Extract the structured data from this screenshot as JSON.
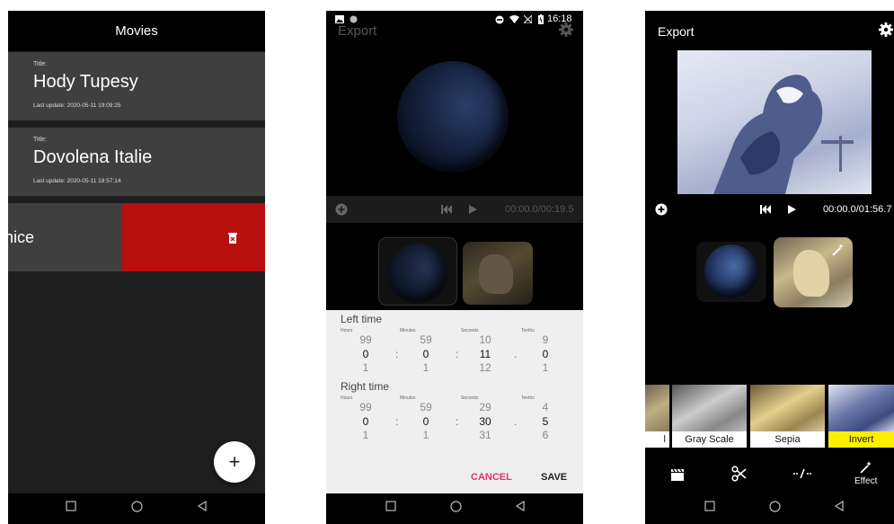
{
  "screen1": {
    "title": "Movies",
    "movies": [
      {
        "title_label": "Title:",
        "title": "Hody Tupesy",
        "updated": "Last update: 2020-05-11 19:09:25"
      },
      {
        "title_label": "Title:",
        "title": "Dovolena Italie",
        "updated": "Last update: 2020-05-11 18:57:14"
      }
    ],
    "swiped_item_text": "nice",
    "fab_label": "+"
  },
  "screen2": {
    "status_time": "16:18",
    "export_label": "Export",
    "time_display": "00:00.0/00:19.5",
    "left_time": {
      "label": "Left time",
      "captions": [
        "Hours",
        "Minutes",
        "Seconds",
        "Tenths"
      ],
      "prev": [
        "99",
        "59",
        "10",
        "9"
      ],
      "current": [
        "0",
        "0",
        "11",
        "0"
      ],
      "next": [
        "1",
        "1",
        "12",
        "1"
      ]
    },
    "right_time": {
      "label": "Right time",
      "captions": [
        "Hours",
        "Minutes",
        "Seconds",
        "Tenths"
      ],
      "prev": [
        "99",
        "59",
        "29",
        "4"
      ],
      "current": [
        "0",
        "0",
        "30",
        "5"
      ],
      "next": [
        "1",
        "1",
        "31",
        "6"
      ]
    },
    "separators": [
      ":",
      ":",
      "."
    ],
    "cancel_label": "CANCEL",
    "save_label": "SAVE"
  },
  "screen3": {
    "export_label": "Export",
    "time_display": "00:00.0/01:56.7",
    "filters": [
      "l",
      "Gray Scale",
      "Sepia",
      "Invert"
    ],
    "selected_filter": "Invert",
    "effect_label": "Effect"
  },
  "colors": {
    "delete_red": "#b80f0f",
    "cancel_pink": "#e0336f",
    "selected_yellow": "#ffee00",
    "card_gray": "#3f3f3f"
  },
  "icons": [
    "trash-icon",
    "plus-icon",
    "settings-gear-icon",
    "skip-back-icon",
    "play-icon",
    "magic-wand-icon",
    "clapperboard-icon",
    "scissors-icon",
    "trim-icon",
    "nav-square-icon",
    "nav-circle-icon",
    "nav-triangle-icon"
  ]
}
